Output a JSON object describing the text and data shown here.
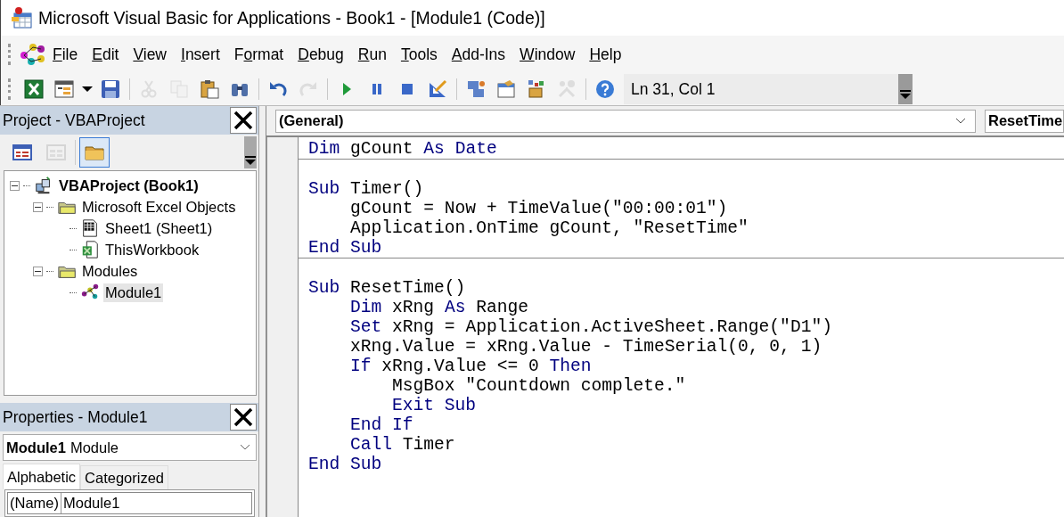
{
  "window": {
    "title": "Microsoft Visual Basic for Applications - Book1 - [Module1 (Code)]"
  },
  "menu": [
    {
      "key": "F",
      "after": "ile"
    },
    {
      "key": "E",
      "after": "dit"
    },
    {
      "key": "V",
      "after": "iew"
    },
    {
      "key": "I",
      "after": "nsert"
    },
    {
      "before": "F",
      "key": "o",
      "after": "rmat"
    },
    {
      "key": "D",
      "after": "ebug"
    },
    {
      "key": "R",
      "after": "un"
    },
    {
      "key": "T",
      "after": "ools"
    },
    {
      "key": "A",
      "after": "dd-Ins"
    },
    {
      "key": "W",
      "after": "indow"
    },
    {
      "key": "H",
      "after": "elp"
    }
  ],
  "toolbar": {
    "buttons": [
      {
        "kind": "excel",
        "disabled": false
      },
      {
        "kind": "insert",
        "disabled": false
      },
      {
        "kind": "save",
        "disabled": false
      },
      {
        "kind": "sep",
        "disabled": false
      },
      {
        "kind": "cut",
        "disabled": true
      },
      {
        "kind": "copy",
        "disabled": true
      },
      {
        "kind": "paste",
        "disabled": false
      },
      {
        "kind": "find",
        "disabled": false
      },
      {
        "kind": "sep",
        "disabled": false
      },
      {
        "kind": "undo",
        "disabled": false
      },
      {
        "kind": "redo",
        "disabled": true
      },
      {
        "kind": "sep",
        "disabled": false
      },
      {
        "kind": "run",
        "disabled": false
      },
      {
        "kind": "pause",
        "disabled": false
      },
      {
        "kind": "stop",
        "disabled": false
      },
      {
        "kind": "design",
        "disabled": false
      },
      {
        "kind": "sep",
        "disabled": false
      },
      {
        "kind": "explorer",
        "disabled": false
      },
      {
        "kind": "properties",
        "disabled": false
      },
      {
        "kind": "browser",
        "disabled": false
      },
      {
        "kind": "tools",
        "disabled": true
      },
      {
        "kind": "sep",
        "disabled": false
      },
      {
        "kind": "help",
        "disabled": false
      }
    ],
    "position": "Ln 31, Col 1"
  },
  "project": {
    "title": "Project - VBAProject",
    "tools": [
      {
        "kind": "view-code",
        "disabled": false,
        "selected": false
      },
      {
        "kind": "view-object",
        "disabled": true,
        "selected": false
      },
      {
        "kind": "toggle-folders",
        "disabled": false,
        "selected": true
      }
    ],
    "tree": [
      {
        "label": "VBAProject (Book1)",
        "kind": "project",
        "expanded": true,
        "selected": false,
        "children": [
          {
            "label": "Microsoft Excel Objects",
            "kind": "folder",
            "expanded": true,
            "selected": false,
            "children": [
              {
                "label": "Sheet1 (Sheet1)",
                "kind": "sheet",
                "selected": false
              },
              {
                "label": "ThisWorkbook",
                "kind": "workbook",
                "selected": false
              }
            ]
          },
          {
            "label": "Modules",
            "kind": "folder",
            "expanded": true,
            "selected": false,
            "children": [
              {
                "label": "Module1",
                "kind": "module",
                "selected": true
              }
            ]
          }
        ]
      }
    ]
  },
  "properties": {
    "title": "Properties - Module1",
    "object_name": "Module1",
    "object_type": "Module",
    "tabs": [
      {
        "label": "Alphabetic",
        "selected": true
      },
      {
        "label": "Categorized",
        "selected": false
      }
    ],
    "rows": [
      {
        "name": "(Name)",
        "value": "Module1"
      }
    ]
  },
  "code": {
    "object": "(General)",
    "procedure": "ResetTime",
    "blocks": [
      {
        "leading_blank": false,
        "lines": [
          {
            "tokens": [
              {
                "kind": "keyword",
                "text": "Dim"
              },
              {
                "kind": "plain",
                "text": " gCount "
              },
              {
                "kind": "keyword",
                "text": "As Date"
              }
            ]
          }
        ]
      },
      {
        "leading_blank": true,
        "lines": [
          {
            "tokens": [
              {
                "kind": "keyword",
                "text": "Sub"
              },
              {
                "kind": "plain",
                "text": " Timer()"
              }
            ],
            "children": [
              {
                "tokens": [
                  {
                    "kind": "plain",
                    "text": "gCount = Now + TimeValue(\"00:00:01\")"
                  }
                ]
              },
              {
                "tokens": [
                  {
                    "kind": "plain",
                    "text": "Application.OnTime gCount, \"ResetTime\""
                  }
                ]
              }
            ]
          },
          {
            "tokens": [
              {
                "kind": "keyword",
                "text": "End Sub"
              }
            ]
          }
        ]
      },
      {
        "leading_blank": true,
        "lines": [
          {
            "tokens": [
              {
                "kind": "keyword",
                "text": "Sub"
              },
              {
                "kind": "plain",
                "text": " ResetTime()"
              }
            ],
            "children": [
              {
                "tokens": [
                  {
                    "kind": "keyword",
                    "text": "Dim"
                  },
                  {
                    "kind": "plain",
                    "text": " xRng "
                  },
                  {
                    "kind": "keyword",
                    "text": "As"
                  },
                  {
                    "kind": "plain",
                    "text": " Range"
                  }
                ]
              },
              {
                "tokens": [
                  {
                    "kind": "keyword",
                    "text": "Set"
                  },
                  {
                    "kind": "plain",
                    "text": " xRng = Application.ActiveSheet.Range(\"D1\")"
                  }
                ]
              },
              {
                "tokens": [
                  {
                    "kind": "plain",
                    "text": "xRng.Value = xRng.Value - TimeSerial(0, 0, 1)"
                  }
                ]
              },
              {
                "tokens": [
                  {
                    "kind": "keyword",
                    "text": "If"
                  },
                  {
                    "kind": "plain",
                    "text": " xRng.Value <= 0 "
                  },
                  {
                    "kind": "keyword",
                    "text": "Then"
                  }
                ],
                "children": [
                  {
                    "tokens": [
                      {
                        "kind": "plain",
                        "text": "MsgBox \"Countdown complete.\""
                      }
                    ]
                  },
                  {
                    "tokens": [
                      {
                        "kind": "keyword",
                        "text": "Exit Sub"
                      }
                    ]
                  }
                ]
              },
              {
                "tokens": [
                  {
                    "kind": "keyword",
                    "text": "End If"
                  }
                ]
              },
              {
                "tokens": [
                  {
                    "kind": "keyword",
                    "text": "Call"
                  },
                  {
                    "kind": "plain",
                    "text": " Timer"
                  }
                ]
              }
            ]
          },
          {
            "tokens": [
              {
                "kind": "keyword",
                "text": "End Sub"
              }
            ]
          }
        ]
      }
    ]
  }
}
